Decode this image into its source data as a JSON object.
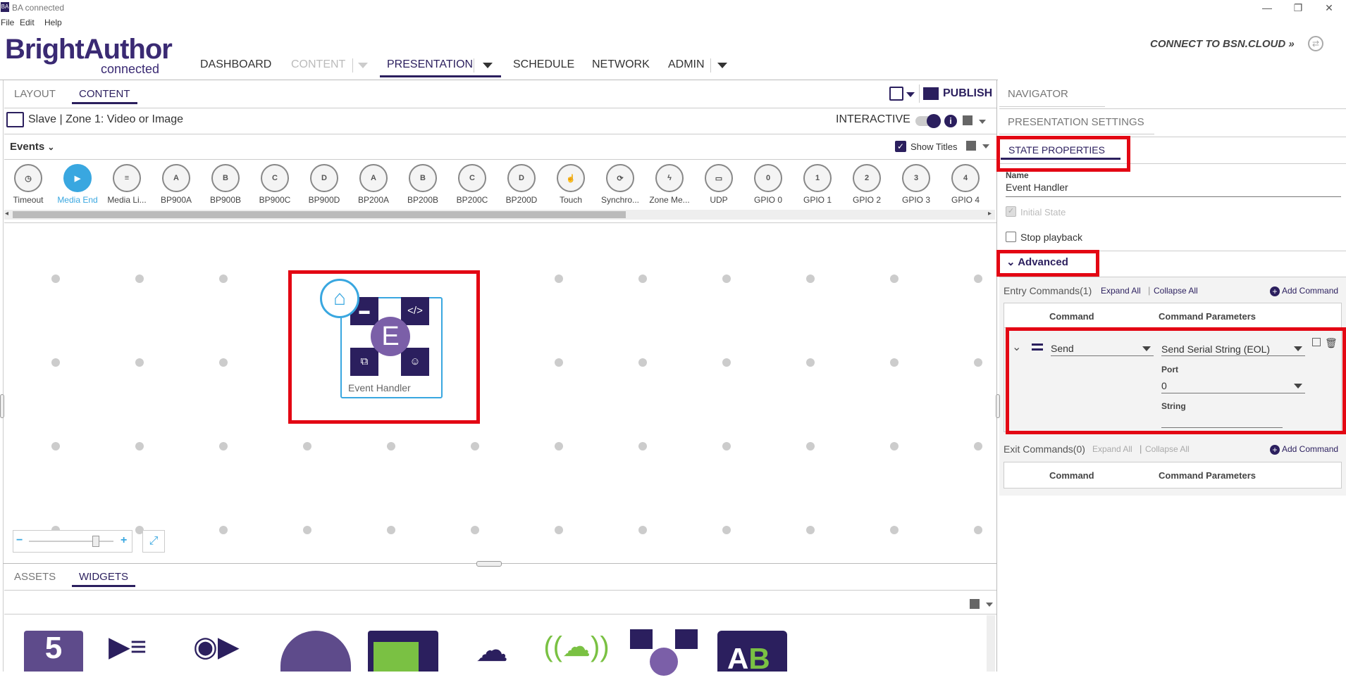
{
  "window": {
    "title": "BA connected",
    "app_icon": "BA"
  },
  "menu": [
    "File",
    "Edit",
    "Help"
  ],
  "brand": {
    "name": "BrightAuthor",
    "sub": "connected"
  },
  "topnav": {
    "dashboard": "DASHBOARD",
    "content": "CONTENT",
    "presentation": "PRESENTATION",
    "schedule": "SCHEDULE",
    "network": "NETWORK",
    "admin": "ADMIN"
  },
  "connect": "CONNECT TO BSN.CLOUD »",
  "left_tabs": {
    "layout": "LAYOUT",
    "content": "CONTENT"
  },
  "publish": "PUBLISH",
  "zone": {
    "title": "Slave | Zone 1: Video or Image",
    "interactive": "INTERACTIVE"
  },
  "events": {
    "label": "Events",
    "show_titles": "Show Titles"
  },
  "event_icons": [
    {
      "label": "Timeout",
      "glyph": "◷"
    },
    {
      "label": "Media End",
      "glyph": "▶"
    },
    {
      "label": "Media Li...",
      "glyph": "≡"
    },
    {
      "label": "BP900A",
      "glyph": "A"
    },
    {
      "label": "BP900B",
      "glyph": "B"
    },
    {
      "label": "BP900C",
      "glyph": "C"
    },
    {
      "label": "BP900D",
      "glyph": "D"
    },
    {
      "label": "BP200A",
      "glyph": "A"
    },
    {
      "label": "BP200B",
      "glyph": "B"
    },
    {
      "label": "BP200C",
      "glyph": "C"
    },
    {
      "label": "BP200D",
      "glyph": "D"
    },
    {
      "label": "Touch",
      "glyph": "☝"
    },
    {
      "label": "Synchro...",
      "glyph": "⟳"
    },
    {
      "label": "Zone Me...",
      "glyph": "ϟ"
    },
    {
      "label": "UDP",
      "glyph": "▭"
    },
    {
      "label": "GPIO 0",
      "glyph": "0"
    },
    {
      "label": "GPIO 1",
      "glyph": "1"
    },
    {
      "label": "GPIO 2",
      "glyph": "2"
    },
    {
      "label": "GPIO 3",
      "glyph": "3"
    },
    {
      "label": "GPIO 4",
      "glyph": "4"
    }
  ],
  "canvas": {
    "state_label": "Event Handler",
    "center_glyph": "E",
    "code_glyph": "</>"
  },
  "bottom_tabs": {
    "assets": "ASSETS",
    "widgets": "WIDGETS"
  },
  "right_panel": {
    "navigator": "NAVIGATOR",
    "presentation_settings": "PRESENTATION SETTINGS",
    "state_properties": "STATE PROPERTIES",
    "name_label": "Name",
    "name_value": "Event Handler",
    "initial_state": "Initial State",
    "stop_playback": "Stop playback",
    "advanced": "Advanced",
    "entry_commands": "Entry Commands(1)",
    "exit_commands": "Exit Commands(0)",
    "expand_all": "Expand All",
    "collapse_all": "Collapse All",
    "add_command": "Add Command",
    "col_command": "Command",
    "col_params": "Command Parameters",
    "command": "Send",
    "command_param": "Send Serial String (EOL)",
    "port_label": "Port",
    "port_value": "0",
    "string_label": "String",
    "string_value": ""
  },
  "colors": {
    "brand": "#2b1f5e",
    "accent": "#39a7e0",
    "highlight": "#e30613"
  }
}
